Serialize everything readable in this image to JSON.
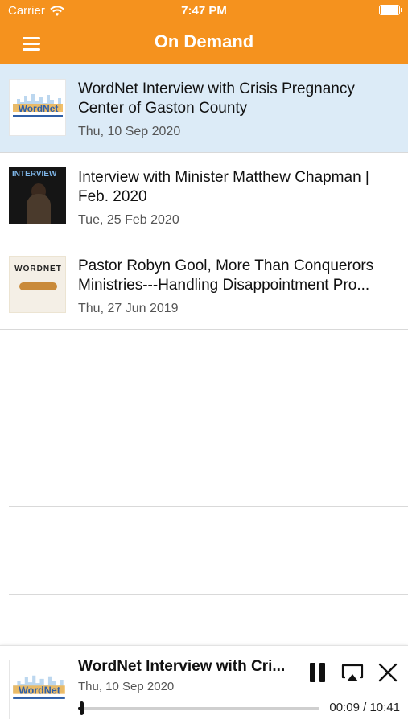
{
  "status_bar": {
    "carrier": "Carrier",
    "time": "7:47 PM"
  },
  "navbar": {
    "title": "On Demand",
    "menu_icon": "hamburger-menu-icon"
  },
  "colors": {
    "accent": "#f5921e",
    "selected_row": "#dcebf7"
  },
  "items": [
    {
      "title": "WordNet Interview with Crisis Pregnancy Center of Gaston County",
      "date": "Thu, 10 Sep 2020",
      "thumb": "WordNet",
      "selected": true
    },
    {
      "title": "Interview with Minister Matthew Chapman | Feb. 2020",
      "date": "Tue, 25 Feb 2020",
      "thumb": "INTERVIEW",
      "selected": false
    },
    {
      "title": "Pastor Robyn Gool, More Than Conquerors Ministries---Handling Disappointment Pro...",
      "date": "Thu, 27 Jun 2019",
      "thumb": "WORDNET",
      "selected": false
    }
  ],
  "player": {
    "title": "WordNet Interview with Cri...",
    "date": "Thu, 10 Sep 2020",
    "time": "00:09 / 10:41",
    "progress": 0.014
  }
}
